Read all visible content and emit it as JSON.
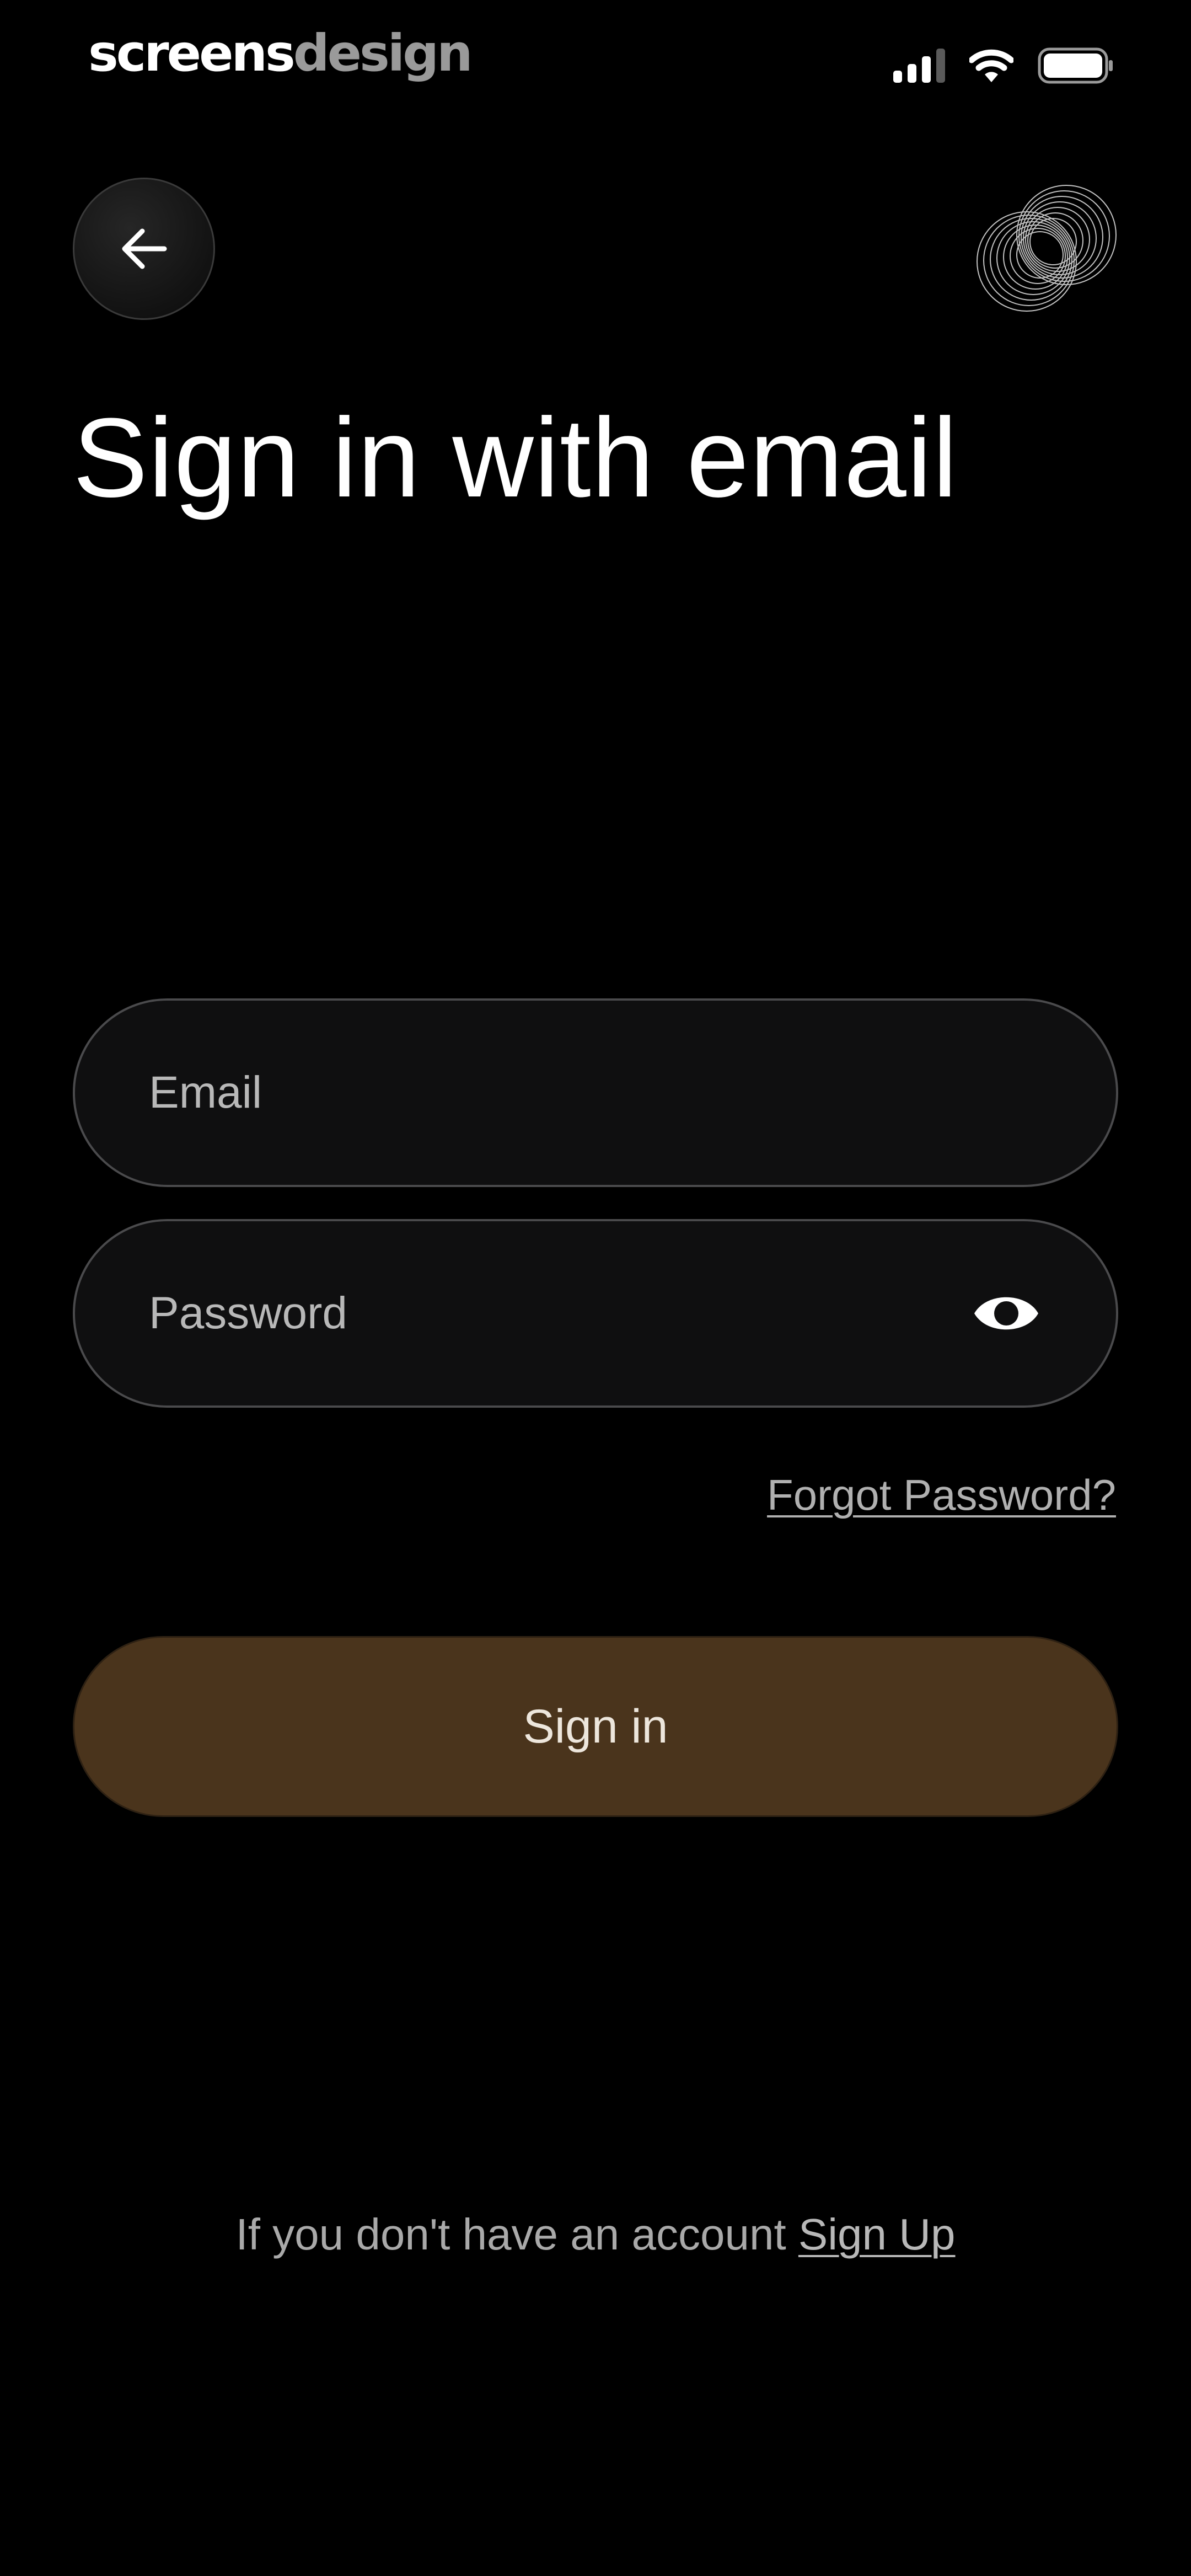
{
  "status_bar": {
    "brand_part1": "screens",
    "brand_part2": "design",
    "icons": [
      "cellular-signal-icon",
      "wifi-icon",
      "battery-icon"
    ]
  },
  "header": {
    "back_icon": "arrow-left-icon",
    "logo_icon": "concentric-rings-logo-icon"
  },
  "title": "Sign in with email",
  "form": {
    "email_placeholder": "Email",
    "email_value": "",
    "password_placeholder": "Password",
    "password_value": "",
    "password_toggle_icon": "eye-icon",
    "forgot_label": "Forgot Password?",
    "submit_label": "Sign in"
  },
  "footer": {
    "prompt": "If you don't have an account ",
    "signup_label": "Sign Up"
  },
  "colors": {
    "background": "#000000",
    "field_background": "#0f0f10",
    "field_border": "#4a4a4c",
    "primary_button": "#4a341c",
    "muted_text": "#a9a9a9"
  }
}
